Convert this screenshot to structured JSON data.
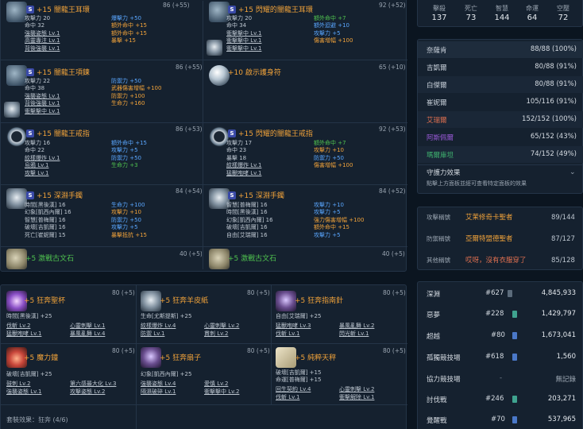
{
  "top_stats": [
    {
      "label": "擊殺",
      "value": "137"
    },
    {
      "label": "死亡",
      "value": "73"
    },
    {
      "label": "智慧",
      "value": "144"
    },
    {
      "label": "命運",
      "value": "64"
    },
    {
      "label": "空壓",
      "value": "72"
    }
  ],
  "equip": {
    "c1": {
      "title": "+15 闇龍王耳環",
      "score": "86 (+55)",
      "lines": [
        [
          "攻擊力 20",
          "",
          ""
        ],
        [
          "命中 32",
          "",
          ""
        ],
        [
          "強襲姿態 Lv.1",
          "u",
          ""
        ],
        [
          "高靈專注 Lv.1",
          "u",
          ""
        ],
        [
          "背後強襲 Lv.1",
          "u",
          ""
        ]
      ],
      "lines2": [
        [
          "爆擊力 +50",
          "b"
        ],
        [
          "額外命中 +15",
          "o"
        ],
        [
          "額外命中 +15",
          "o"
        ],
        [
          "暴擊 +15",
          "o"
        ]
      ]
    },
    "c2": {
      "title": "+15 閃耀的闇龍王耳環",
      "score": "92 (+52)",
      "lines": [
        [
          "攻擊力 20",
          "",
          ""
        ],
        [
          "命中 34",
          "",
          ""
        ],
        [
          "衝擊擊中 Lv.1",
          "u",
          ""
        ],
        [
          "衝擊擊中 Lv.1",
          "u",
          ""
        ],
        [
          "衝擊擊中 Lv.1",
          "u",
          ""
        ]
      ],
      "lines2": [
        [
          "額外命中 +7",
          "g"
        ],
        [
          "額外迴避 +10",
          "b"
        ],
        [
          "攻擊力 +5",
          "b"
        ],
        [
          "傷害增幅 +100",
          "o"
        ]
      ]
    },
    "c3": {
      "title": "+15 闇龍王項鍊",
      "score": "86 (+55)",
      "lines": [
        [
          "攻擊力 22",
          "",
          ""
        ],
        [
          "命中 38",
          "",
          ""
        ],
        [
          "強襲姿態 Lv.1",
          "u",
          ""
        ],
        [
          "背後強襲 Lv.1",
          "u",
          ""
        ],
        [
          "衝擊擊中 Lv.1",
          "u",
          ""
        ]
      ],
      "lines2": [
        [
          "防禦力 +50",
          "b"
        ],
        [
          "武器傷害增幅 +100",
          "o"
        ],
        [
          "防禦力 +100",
          "o"
        ],
        [
          "生命力 +160",
          "o"
        ]
      ]
    },
    "c4": {
      "title": "+10 啟示護身符",
      "score": "65 (+10)"
    },
    "c5": {
      "title": "+15 闇龍王戒指",
      "score": "86 (+53)",
      "lines": [
        [
          "攻擊力 16",
          "",
          ""
        ],
        [
          "命中 22",
          "",
          ""
        ],
        [
          "紋樣爆炸 Lv.1",
          "u",
          ""
        ],
        [
          "烏鴉 Lv.1",
          "u",
          ""
        ],
        [
          "攻擊 Lv.1",
          "u",
          ""
        ]
      ],
      "lines2": [
        [
          "額外命中 +15",
          "b"
        ],
        [
          "攻擊力 +5",
          "b"
        ],
        [
          "防禦力 +50",
          "b"
        ],
        [
          "生命力 +3",
          "g"
        ]
      ]
    },
    "c6": {
      "title": "+15 閃耀的闇龍王戒指",
      "score": "92 (+53)",
      "lines": [
        [
          "攻擊力 17",
          "",
          ""
        ],
        [
          "命中 23",
          "",
          ""
        ],
        [
          "暴擊 18",
          "",
          ""
        ],
        [
          "紋樣爆炸 Lv.1",
          "u",
          ""
        ],
        [
          "猛獸咆哮 Lv.1",
          "u",
          ""
        ]
      ],
      "lines2": [
        [
          "額外命中 +7",
          "g"
        ],
        [
          "攻擊力 +10",
          "o"
        ],
        [
          "防禦力 +50",
          "b"
        ],
        [
          "傷害增幅 +100",
          "o"
        ]
      ]
    },
    "c7": {
      "title": "+15 深淵手鐲",
      "score": "84 (+54)",
      "lines": [
        [
          "時間[黑後漢] 16",
          "",
          ""
        ],
        [
          "幻象[凱西內爾] 16",
          "",
          ""
        ],
        [
          "智慧[普梅爾] 16",
          "",
          ""
        ],
        [
          "破壞[吉凱爾] 16",
          "",
          ""
        ],
        [
          "死亡[崔妮爾] 15",
          "",
          ""
        ]
      ],
      "lines2": [
        [
          "生命力 +100",
          "b"
        ],
        [
          "攻擊力 +10",
          "o"
        ],
        [
          "防禦力 +50",
          "b"
        ],
        [
          "攻擊力 +5",
          "b"
        ],
        [
          "暴擊抵抗 +15",
          "o"
        ]
      ]
    },
    "c8": {
      "title": "+15 深淵手鐲",
      "score": "84 (+52)",
      "lines": [
        [
          "智慧[普梅爾] 16",
          "",
          ""
        ],
        [
          "時間[黑後漢] 16",
          "",
          ""
        ],
        [
          "幻象[凱西內爾] 16",
          "",
          ""
        ],
        [
          "破壞[吉凱爾] 16",
          "",
          ""
        ],
        [
          "自由[艾瑞爾] 16",
          "",
          ""
        ]
      ],
      "lines2": [
        [
          "攻擊力 +10",
          "b"
        ],
        [
          "攻擊力 +5",
          "b"
        ],
        [
          "強力傷害增幅 +100",
          "o"
        ],
        [
          "額外命中 +15",
          "o"
        ],
        [
          "攻擊力 +5",
          "b"
        ]
      ]
    },
    "c9": {
      "title": "+5 激戰古文石",
      "score": "40 (+5)"
    },
    "c10": {
      "title": "+5 激戰古文石",
      "score": "40 (+5)"
    }
  },
  "runes": {
    "r1": {
      "title": "+5 狂奔聖杯",
      "score": "80 (+5)",
      "stat": "時間[黑後漢] +25",
      "s1": "伐斬 Lv.2",
      "s2": "心靈刺擊 Lv.1",
      "s3": "猛獸咆哮 Lv.1",
      "s4": "暴風亂舞 Lv.4"
    },
    "r2": {
      "title": "+5 狂奔羊皮紙",
      "score": "80 (+5)",
      "stat": "生命[尤斯提斯] +25",
      "s1": "紋樣爆炸 Lv.4",
      "s2": "心靈刺擊 Lv.2",
      "s3": "防禦 Lv.1",
      "s4": "貫刺 Lv.2"
    },
    "r3": {
      "title": "+5 狂奔指南針",
      "score": "80 (+5)",
      "stat": "自由[艾瑞爾] +25",
      "s1": "猛獸咆哮 Lv.3",
      "s2": "暴風亂舞 Lv.2",
      "s3": "伐斬 Lv.1",
      "s4": "閃光斬 Lv.1"
    },
    "r4": {
      "title": "+5 魔力鐘",
      "score": "80 (+5)",
      "stat": "破壞[吉凱爾] +25",
      "s1": "鼓刺 Lv.2",
      "s2": "第六感最大化 Lv.3",
      "s3": "強襲姿態 Lv.1",
      "s4": "攻擊姿態 Lv.2"
    },
    "r5": {
      "title": "+5 狂奔扇子",
      "score": "80 (+5)",
      "stat": "幻象[凱西內爾] +25",
      "s1": "強襲姿態 Lv.4",
      "s2": "愛慎 Lv.2",
      "s3": "隔濕破碎 Lv.1",
      "s4": "衝擊擊中 Lv.2"
    },
    "r6": {
      "title": "+5 純粹天秤",
      "score": "80 (+5)",
      "stat": "破壞[吉凱爾] +15",
      "stat2": "命運[普梅爾] +15",
      "s1": "回生契約 Lv.4",
      "s2": "心靈刺擊 Lv.2",
      "s3": "伐斬 Lv.1",
      "s4": "衝擊解除 Lv.1"
    }
  },
  "set_effect": "套裝效果：狂奔 (4/6)",
  "gods": [
    {
      "name": "奈薩肯",
      "value": "88/88 (100%)",
      "color": "#d5dbe2"
    },
    {
      "name": "吉凱爾",
      "value": "80/88 (91%)",
      "color": "#d5dbe2"
    },
    {
      "name": "白傑爾",
      "value": "80/88 (91%)",
      "color": "#d5dbe2"
    },
    {
      "name": "崔妮爾",
      "value": "105/116 (91%)",
      "color": "#d5dbe2"
    },
    {
      "name": "艾瑞爾",
      "value": "152/152 (100%)",
      "color": "#e07050"
    },
    {
      "name": "阿斯佩爾",
      "value": "65/152 (43%)",
      "color": "#9a5ad8"
    },
    {
      "name": "瑪爾庫坦",
      "value": "74/152 (49%)",
      "color": "#3fb26f"
    }
  ],
  "guard": {
    "title": "守護力效果",
    "desc": "點擊上方面板並經可查看特定面板的效果"
  },
  "titles": [
    {
      "cat": "攻擊稱號",
      "name": "艾茉修奇卡聖者",
      "value": "89/144",
      "color": "#f0a23a"
    },
    {
      "cat": "防禦稱號",
      "name": "亞爾特盟德聖者",
      "value": "87/127",
      "color": "#f0a23a"
    },
    {
      "cat": "其他稱號",
      "name": "哎呀，沒有衣服穿了",
      "value": "85/128",
      "color": "#e07050"
    }
  ],
  "ranks": [
    {
      "name": "深淵",
      "rank": "#627",
      "value": "4,845,933",
      "mark": "#7a8a99"
    },
    {
      "name": "惡夢",
      "rank": "#228",
      "value": "1,429,797",
      "mark": "#3fa38f"
    },
    {
      "name": "超越",
      "rank": "#80",
      "value": "1,673,041",
      "mark": "#4a78c8"
    },
    {
      "name": "孤獨競技場",
      "rank": "#618",
      "value": "1,560",
      "mark": "#4a78c8"
    },
    {
      "name": "協力競技場",
      "rank": "-",
      "value": "無記錄",
      "mark": ""
    },
    {
      "name": "討伐戰",
      "rank": "#246",
      "value": "203,271",
      "mark": "#3fa38f"
    },
    {
      "name": "覺醒戰",
      "rank": "#70",
      "value": "537,965",
      "mark": "#4a78c8"
    }
  ]
}
